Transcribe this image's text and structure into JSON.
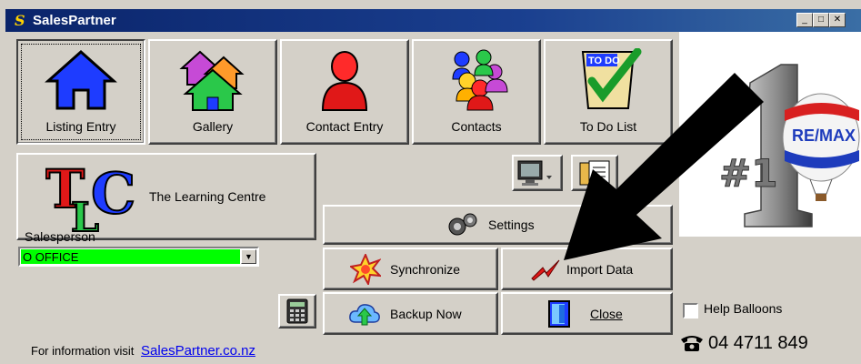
{
  "window": {
    "title_glyph": "S",
    "title": "SalesPartner"
  },
  "toolbar": [
    {
      "label": "Listing Entry",
      "icon": "house-icon"
    },
    {
      "label": "Gallery",
      "icon": "houses-icon"
    },
    {
      "label": "Contact Entry",
      "icon": "person-icon"
    },
    {
      "label": "Contacts",
      "icon": "people-icon"
    },
    {
      "label": "To Do List",
      "icon": "todo-icon"
    }
  ],
  "learning": {
    "logo": "TLC",
    "label": "The Learning Centre"
  },
  "actions": {
    "settings": "Settings",
    "synchronize": "Synchronize",
    "import": "Import Data",
    "backup": "Backup Now",
    "close": "Close"
  },
  "salesperson": {
    "label": "Salesperson",
    "value": "O OFFICE"
  },
  "footer": {
    "text": "For information visit",
    "link": "SalesPartner.co.nz"
  },
  "help": {
    "label": "Help Balloons",
    "checked": false
  },
  "phone": "04 4711 849",
  "brand": {
    "logo_text": "RE/MAX",
    "number_mark": "#1"
  },
  "colors": {
    "titlebar": "#0a246a",
    "combo_bg": "#00ff00",
    "link": "#0000ee"
  }
}
